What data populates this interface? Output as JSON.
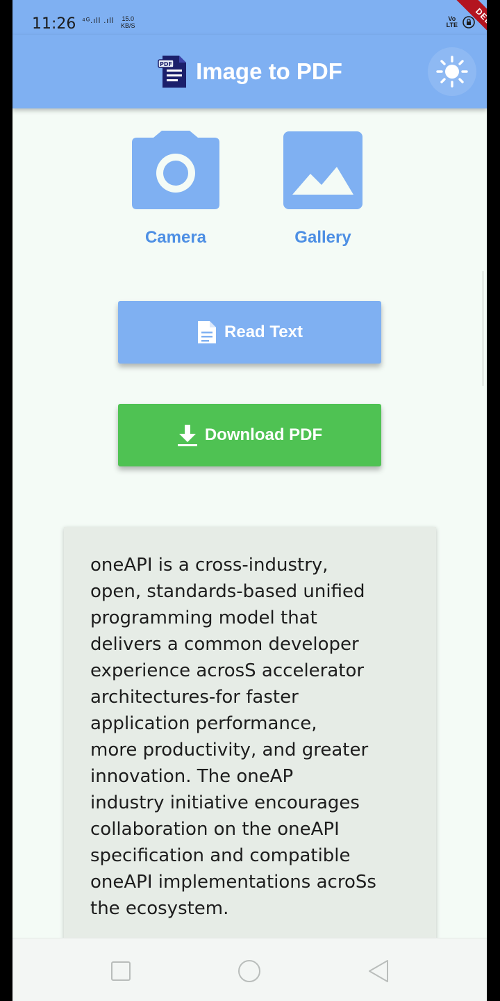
{
  "status_bar": {
    "time": "11:26",
    "network": "⁴ᴳ.ıll .ıll",
    "speed": "15.0\nKB/S",
    "volte": "Vo\nLTE"
  },
  "app_bar": {
    "title": "Image to PDF",
    "logo_icon": "pdf-file-icon",
    "theme_icon": "sun-icon",
    "debug_label": "DEBUG"
  },
  "sources": [
    {
      "label": "Camera",
      "icon": "camera-icon"
    },
    {
      "label": "Gallery",
      "icon": "image-icon"
    }
  ],
  "actions": {
    "read_text": {
      "label": "Read Text",
      "icon": "document-icon"
    },
    "download_pdf": {
      "label": "Download PDF",
      "icon": "download-icon"
    }
  },
  "extracted_text": "oneAPI is a cross-industry,\nopen, standards-based unified\nprogramming model that\ndelivers a common developer\nexperience acrosS accelerator\narchitectures-for faster\napplication performance,\nmore productivity, and greater\ninnovation. The oneAP\nindustry initiative encourages\ncollaboration on the oneAPI\nspecification and compatible\noneAPI implementations acroSs\nthe ecosystem.",
  "colors": {
    "primary": "#7fb0f2",
    "accent_text": "#4d8fe4",
    "download": "#4fc253",
    "background": "#f4fbf6",
    "card": "#e6ece6"
  },
  "nav": [
    "recents-icon",
    "home-icon",
    "back-icon"
  ]
}
